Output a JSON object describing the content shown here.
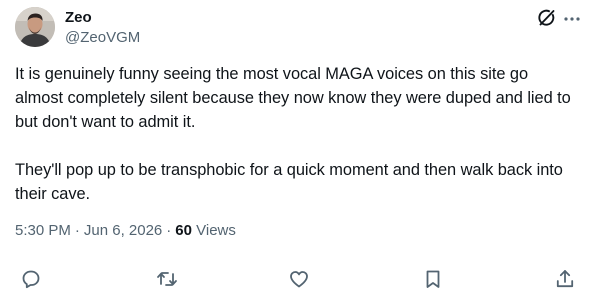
{
  "author": {
    "name": "Zeo",
    "handle": "@ZeoVGM"
  },
  "tweet": {
    "text": "It is genuinely funny seeing the most vocal MAGA voices on this site go almost completely silent because they now know they were duped and lied to but don't want to admit it.\n\nThey'll pop up to be transphobic for a quick moment and then walk back into their cave.",
    "time": "5:30 PM",
    "separator1": "·",
    "date": "Jun 6, 2026",
    "separator2": "·",
    "views_count": "60",
    "views_label": "Views"
  },
  "header_icons": [
    "grok-icon",
    "more-icon"
  ],
  "action_icons": [
    "reply-icon",
    "retweet-icon",
    "like-icon",
    "bookmark-icon",
    "share-icon"
  ],
  "colors": {
    "text": "#0f1419",
    "secondary": "#536471"
  }
}
